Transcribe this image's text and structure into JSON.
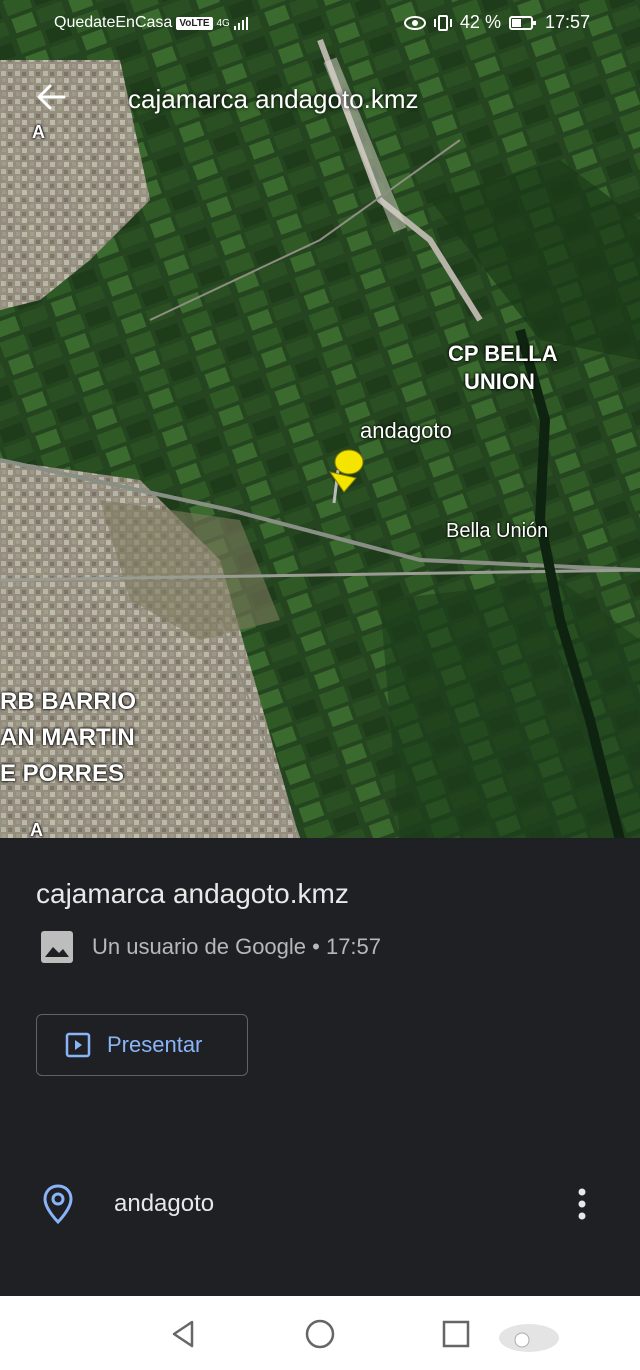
{
  "status_bar": {
    "carrier": "QuedateEnCasa",
    "volte": "VoLTE",
    "network": "4G",
    "battery": "42 %",
    "time": "17:57"
  },
  "header": {
    "title": "cajamarca andagoto.kmz",
    "back_icon": "arrow-back-icon"
  },
  "map": {
    "labels": {
      "cp_bella_union_line1": "CP BELLA",
      "cp_bella_union_line2": "UNION",
      "pin_label": "andagoto",
      "bella_union": "Bella Unión",
      "barrio_line1": "RB BARRIO",
      "barrio_line2": "AN MARTIN",
      "barrio_line3": "E PORRES",
      "letter_a_top": "A",
      "letter_a_bottom": "A"
    },
    "pin_color": "#f5e400"
  },
  "sheet": {
    "title": "cajamarca andagoto.kmz",
    "meta": "Un usuario de Google • 17:57",
    "present_label": "Presentar",
    "place_name": "andagoto",
    "accent_color": "#8ab4f8"
  },
  "nav": {
    "back": "nav-back-icon",
    "home": "nav-home-icon",
    "recents": "nav-recents-icon"
  }
}
